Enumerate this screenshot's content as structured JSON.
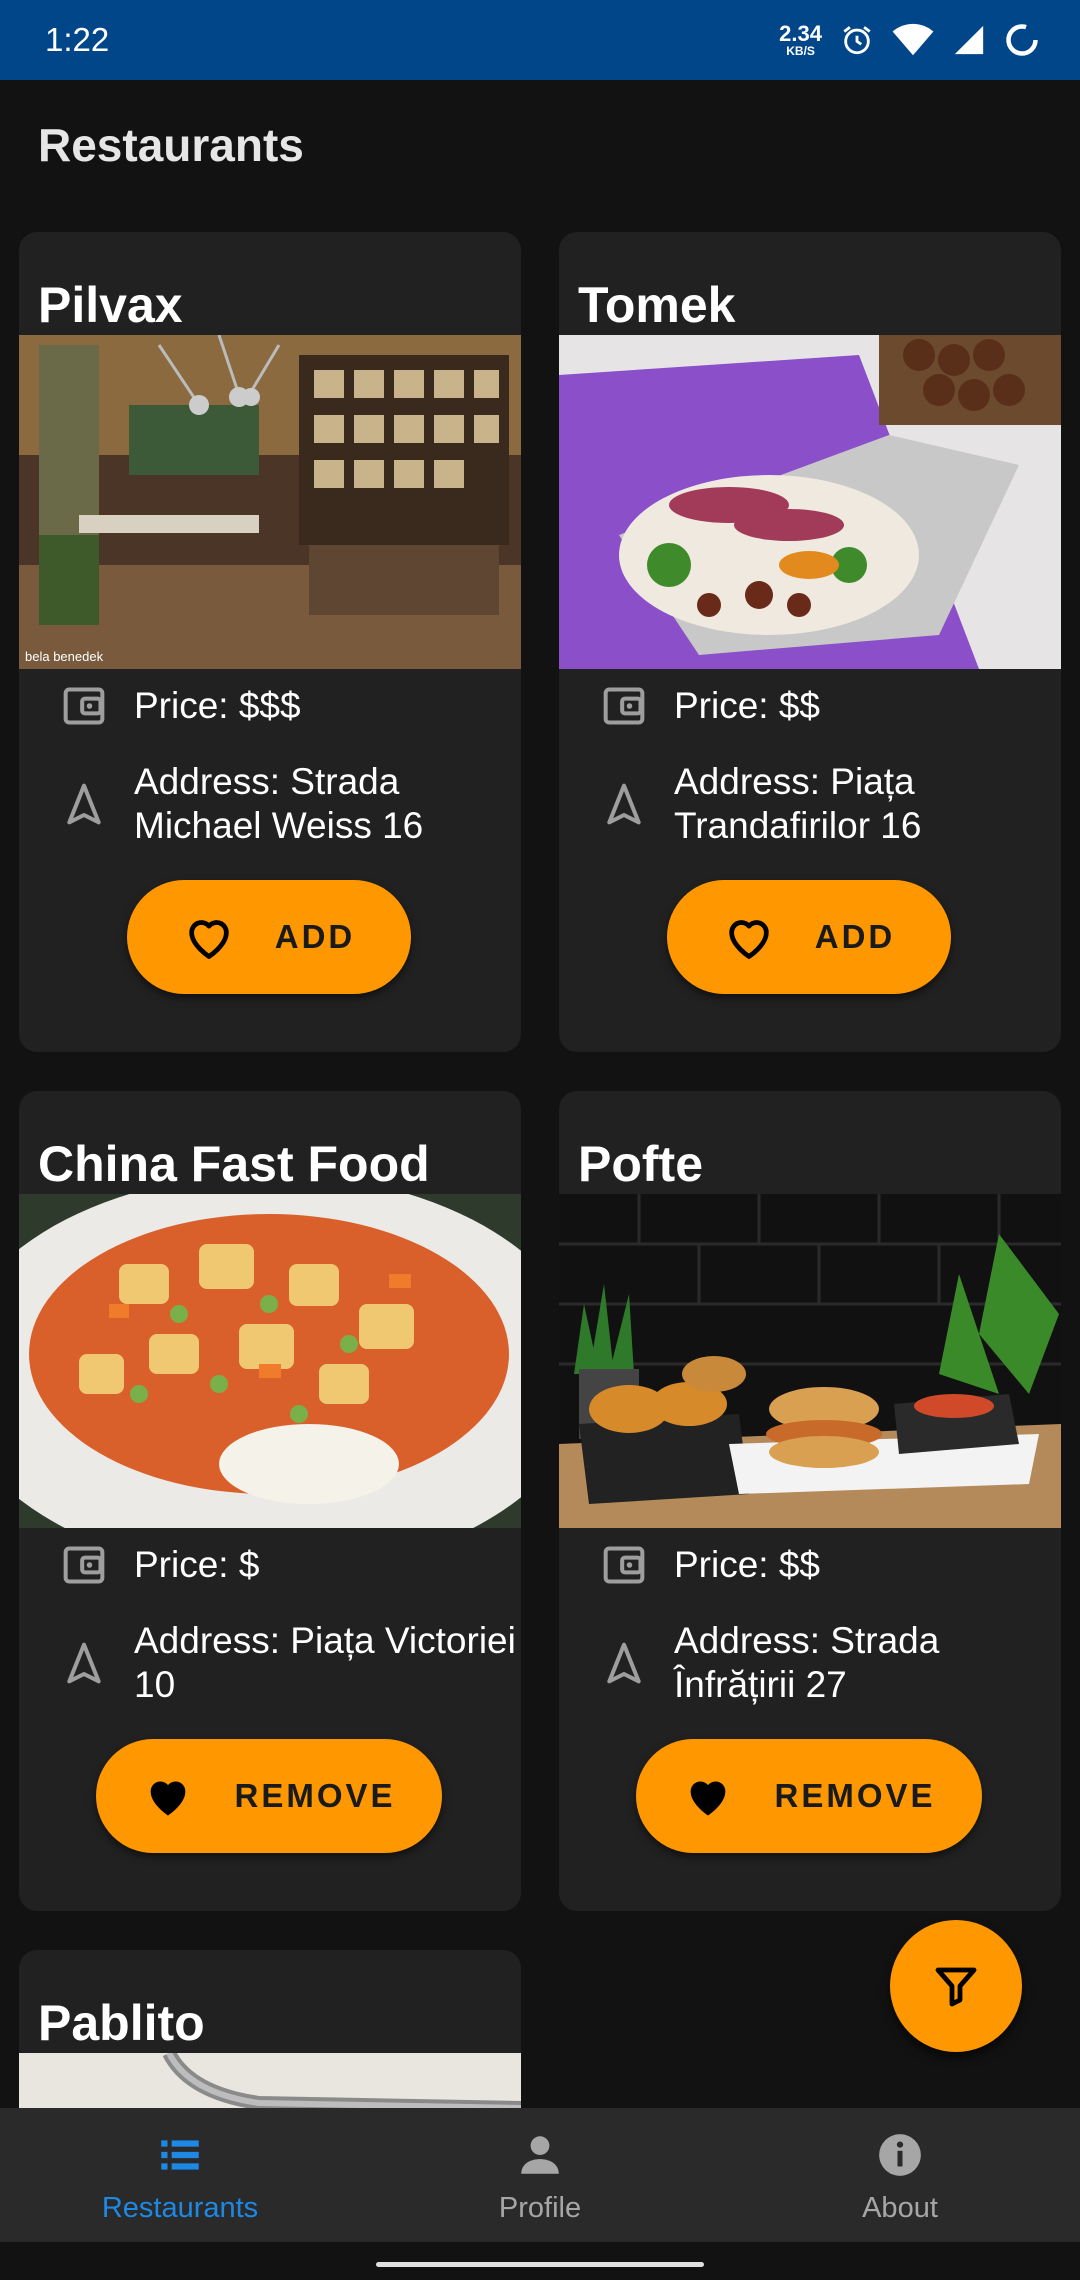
{
  "status_bar": {
    "time": "1:22",
    "net_speed_value": "2.34",
    "net_speed_unit": "KB/S"
  },
  "page": {
    "title": "Restaurants"
  },
  "restaurants": [
    {
      "name": "Pilvax",
      "price": "Price: $$$",
      "address": "Address: Strada Michael Weiss 16",
      "button_label": "ADD",
      "favorite": false,
      "image": "restaurant-interior-photo",
      "watermark": "bela benedek"
    },
    {
      "name": "Tomek",
      "price": "Price: $$",
      "address": "Address: Piața Trandafirilor 16",
      "button_label": "ADD",
      "favorite": false,
      "image": "shawarma-wrap-photo"
    },
    {
      "name": "China Fast Food",
      "price": "Price: $",
      "address": "Address: Piața Victoriei 10",
      "button_label": "REMOVE",
      "favorite": true,
      "image": "sweet-sour-chicken-plate-photo"
    },
    {
      "name": "Pofte",
      "price": "Price: $$",
      "address": "Address: Strada Înfrățirii 27",
      "button_label": "REMOVE",
      "favorite": true,
      "image": "burger-fries-tray-photo"
    },
    {
      "name": "Pablito",
      "image": "restaurant-ceiling-photo"
    }
  ],
  "fab": {
    "icon": "filter-icon"
  },
  "bottom_nav": [
    {
      "label": "Restaurants",
      "icon": "list-icon",
      "active": true
    },
    {
      "label": "Profile",
      "icon": "person-icon",
      "active": false
    },
    {
      "label": "About",
      "icon": "info-icon",
      "active": false
    }
  ],
  "colors": {
    "accent": "#ff9800",
    "active_nav": "#1e88e5",
    "status_bar": "#02468a",
    "card": "#212121",
    "background": "#121212"
  }
}
